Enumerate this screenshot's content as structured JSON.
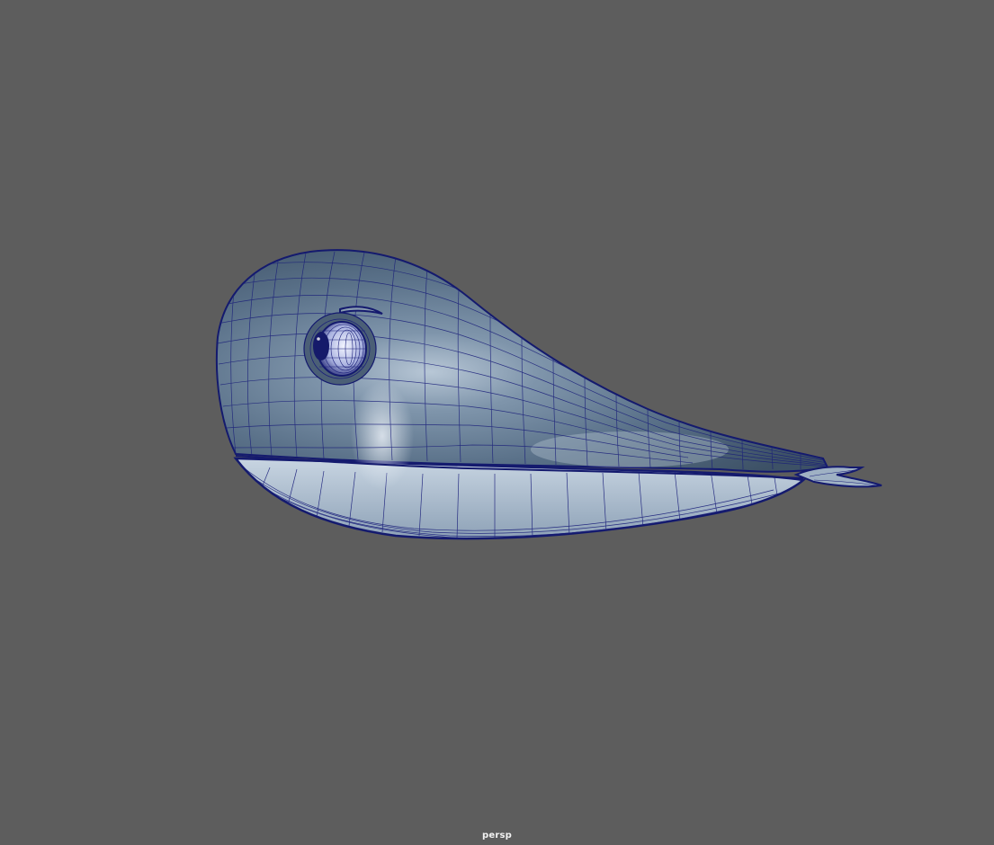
{
  "viewport": {
    "camera_label": "persp",
    "background_color": "#5d5d5d"
  },
  "model": {
    "subject": "whale-mesh",
    "surface_color": "#587086",
    "wireframe_color": "#1a1f7a",
    "highlight_color": "#c9d6e4"
  }
}
